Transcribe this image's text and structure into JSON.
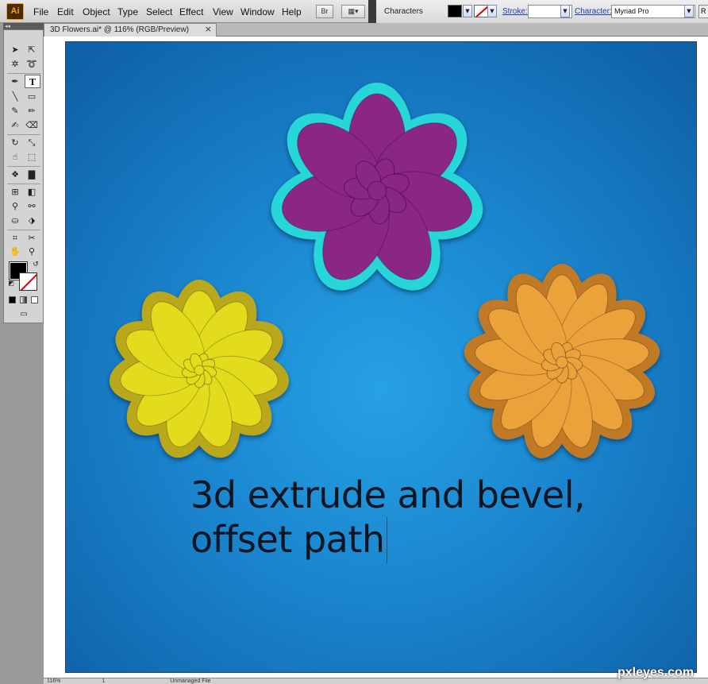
{
  "app": {
    "logo_text": "Ai"
  },
  "menu": [
    "File",
    "Edit",
    "Object",
    "Type",
    "Select",
    "Effect",
    "View",
    "Window",
    "Help"
  ],
  "toolbar": {
    "bridge_label": "Br"
  },
  "control_panel": {
    "title": "Characters",
    "stroke_label": "Stroke:",
    "character_label": "Character:",
    "font_value": "Myriad Pro",
    "extra_label": "R",
    "fill_color": "#000000"
  },
  "document": {
    "tab_title": "3D Flowers.ai* @ 116% (RGB/Preview)",
    "close_glyph": "×"
  },
  "tools": {
    "grip": "◂◂",
    "icons": [
      "selection-tool",
      "direct-selection-tool",
      "magic-wand-tool",
      "lasso-tool",
      "pen-tool",
      "type-tool",
      "line-tool",
      "rectangle-tool",
      "paintbrush-tool",
      "pencil-tool",
      "blob-brush-tool",
      "eraser-tool",
      "rotate-tool",
      "scale-tool",
      "warp-tool",
      "free-transform-tool",
      "symbol-sprayer-tool",
      "column-graph-tool",
      "mesh-tool",
      "gradient-tool",
      "eyedropper-tool",
      "blend-tool",
      "live-paint-bucket-tool",
      "live-paint-selection-tool",
      "artboard-tool",
      "slice-tool",
      "hand-tool",
      "zoom-tool"
    ]
  },
  "canvas": {
    "caption_line1": "3d extrude and bevel,",
    "caption_line2": "offset path",
    "background_color": "#1a86cf",
    "flowers": [
      {
        "name": "purple-flower",
        "petal_color": "#8a2585",
        "outline_color": "#28d6d8",
        "petals": 7
      },
      {
        "name": "yellow-flower",
        "petal_color": "#e3dc1e",
        "outline_color": "#b9a81c",
        "petals": 11
      },
      {
        "name": "orange-flower",
        "petal_color": "#eba23a",
        "outline_color": "#c07a25",
        "petals": 13
      }
    ]
  },
  "status": {
    "zoom": "116%",
    "page": "1",
    "info": "Unmanaged File"
  },
  "watermark": "pxleyes.com"
}
